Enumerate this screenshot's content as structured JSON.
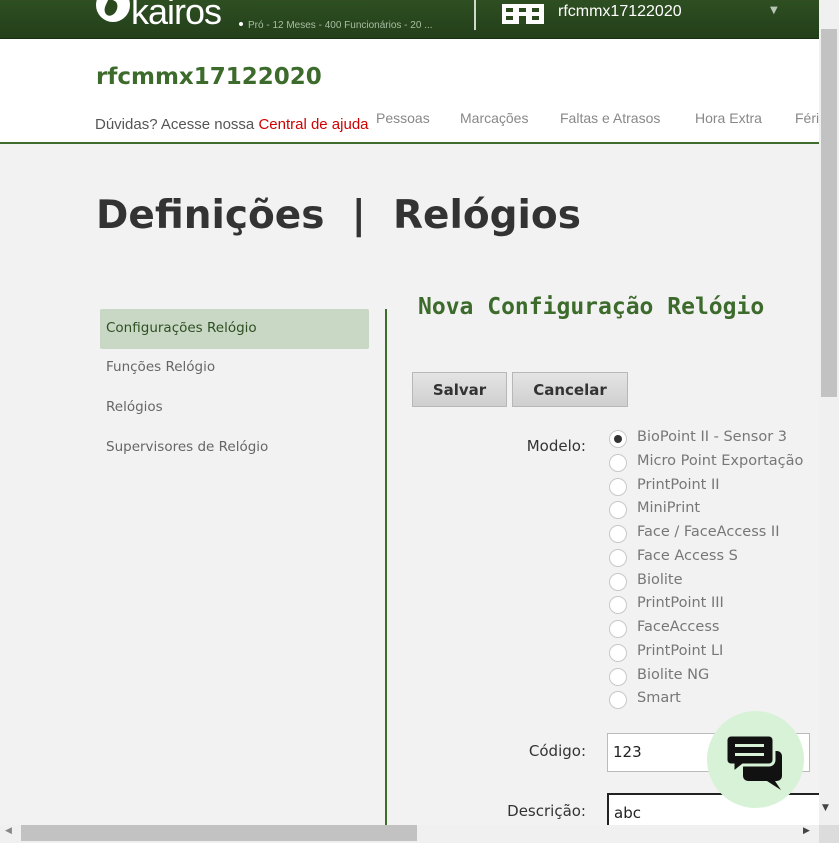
{
  "topbar": {
    "logo_text": "kairos",
    "plan_text": "Pró - 12 Meses - 400 Funcionários - 20 ...",
    "company_name": "rfcmmx17122020",
    "company_caret": "▼"
  },
  "header": {
    "company_title": "rfcmmx17122020",
    "help_prefix": "Dúvidas? Acesse nossa ",
    "help_link": "Central de ajuda",
    "nav": [
      "Pessoas",
      "Marcações",
      "Faltas e Atrasos",
      "Hora Extra",
      "Féri"
    ]
  },
  "page": {
    "title": "Definições  |  Relógios"
  },
  "sidebar": {
    "items": [
      {
        "label": "Configurações Relógio",
        "active": true
      },
      {
        "label": "Funções Relógio"
      },
      {
        "label": "Relógios"
      },
      {
        "label": "Supervisores de Relógio"
      }
    ]
  },
  "form": {
    "title": "Nova Configuração Relógio",
    "save_label": "Salvar",
    "cancel_label": "Cancelar",
    "model_label": "Modelo:",
    "models": [
      "BioPoint II - Sensor 3",
      "Micro Point Exportação",
      "PrintPoint II",
      "MiniPrint",
      "Face / FaceAccess II",
      "Face Access S",
      "Biolite",
      "PrintPoint III",
      "FaceAccess",
      "PrintPoint LI",
      "Biolite NG",
      "Smart"
    ],
    "selected_model": "BioPoint II - Sensor 3",
    "code_label": "Código:",
    "code_value": "123",
    "description_label": "Descrição:",
    "description_value": "abc"
  },
  "icons": {
    "chat": "chat-bubbles-icon",
    "company": "building-icon",
    "logo": "kairos-logo"
  },
  "colors": {
    "brand_green": "#3c6b2c",
    "topbar_green": "#2a4a1e",
    "help_link_red": "#d00000",
    "active_menu_bg": "#c9d8c5",
    "chat_bg": "#d8f2d8"
  }
}
